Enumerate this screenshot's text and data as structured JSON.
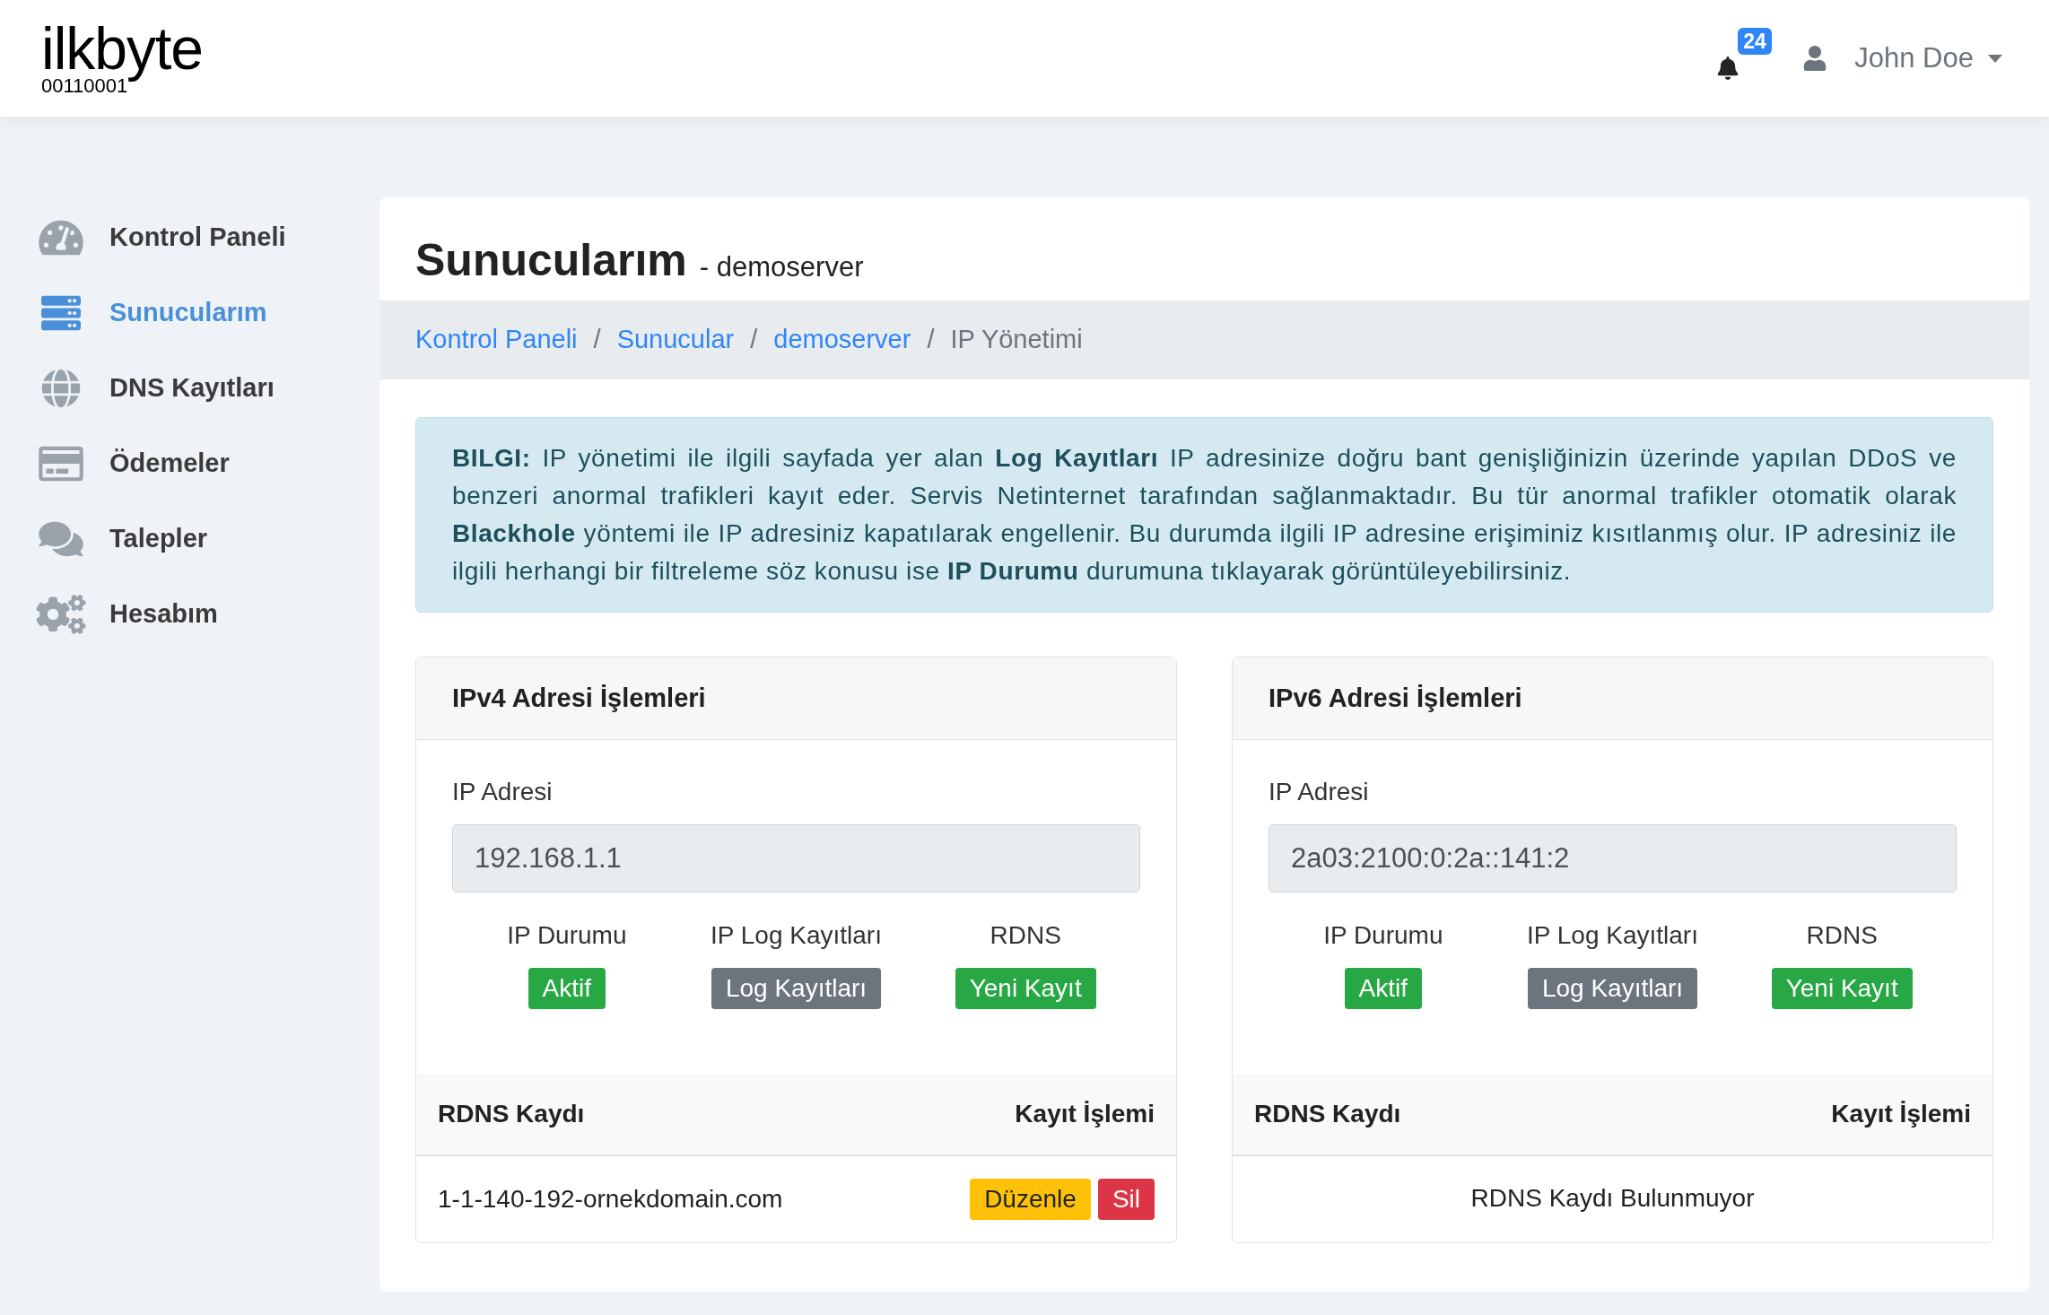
{
  "header": {
    "logo": {
      "name": "ilkbyte",
      "tagline": "00110001"
    },
    "notifications": {
      "count": "24"
    },
    "user": {
      "name": "John Doe"
    }
  },
  "sidebar": {
    "items": [
      {
        "label": "Kontrol Paneli",
        "selected": false
      },
      {
        "label": "Sunucularım",
        "selected": true
      },
      {
        "label": "DNS Kayıtları",
        "selected": false
      },
      {
        "label": "Ödemeler",
        "selected": false
      },
      {
        "label": "Talepler",
        "selected": false
      },
      {
        "label": "Hesabım",
        "selected": false
      }
    ]
  },
  "page": {
    "title": "Sunucularım",
    "subtitle": "- demoserver",
    "breadcrumb_separator": "/",
    "breadcrumb": [
      {
        "label": "Kontrol Paneli",
        "kind": "link"
      },
      {
        "label": "Sunucular",
        "kind": "link"
      },
      {
        "label": "demoserver",
        "kind": "link"
      },
      {
        "label": "IP Yönetimi",
        "kind": "current"
      }
    ],
    "alert": "**BILGI:** IP yönetimi ile ilgili sayfada yer alan **Log Kayıtları** IP adresinize doğru bant genişliğinizin üzerinde yapılan DDoS ve benzeri anormal trafikleri kayıt eder. Servis Netinternet tarafından sağlanmaktadır. Bu tür anormal trafikler otomatik olarak **Blackhole** yöntemi ile IP adresiniz kapatılarak engellenir. Bu durumda ilgili IP adresine erişiminiz kısıtlanmış olur. IP adresiniz ile ilgili herhangi bir filtreleme söz konusu ise **IP Durumu** durumuna tıklayarak görüntüleyebilirsiniz."
  },
  "panels": [
    {
      "title": "IPv4 Adresi İşlemleri",
      "ip_label": "IP Adresi",
      "ip_value": "192.168.1.1",
      "actions": [
        {
          "label": "IP Durumu",
          "button": {
            "label": "Aktif",
            "kind": "success"
          }
        },
        {
          "label": "IP Log Kayıtları",
          "button": {
            "label": "Log Kayıtları",
            "kind": "secondary"
          }
        },
        {
          "label": "RDNS",
          "button": {
            "label": "Yeni Kayıt",
            "kind": "success"
          }
        }
      ],
      "table": {
        "columns": [
          "RDNS Kaydı",
          "Kayıt İşlemi"
        ],
        "rows": [
          {
            "domain": "1-1-140-192-ornekdomain.com",
            "buttons": [
              {
                "label": "Düzenle",
                "kind": "warning"
              },
              {
                "label": "Sil",
                "kind": "danger"
              }
            ]
          }
        ]
      }
    },
    {
      "title": "IPv6 Adresi İşlemleri",
      "ip_label": "IP Adresi",
      "ip_value": "2a03:2100:0:2a::141:2",
      "actions": [
        {
          "label": "IP Durumu",
          "button": {
            "label": "Aktif",
            "kind": "success"
          }
        },
        {
          "label": "IP Log Kayıtları",
          "button": {
            "label": "Log Kayıtları",
            "kind": "secondary"
          }
        },
        {
          "label": "RDNS",
          "button": {
            "label": "Yeni Kayıt",
            "kind": "success"
          }
        }
      ],
      "table": {
        "columns": [
          "RDNS Kaydı",
          "Kayıt İşlemi"
        ],
        "empty_text": "RDNS Kaydı Bulunmuyor"
      }
    }
  ]
}
